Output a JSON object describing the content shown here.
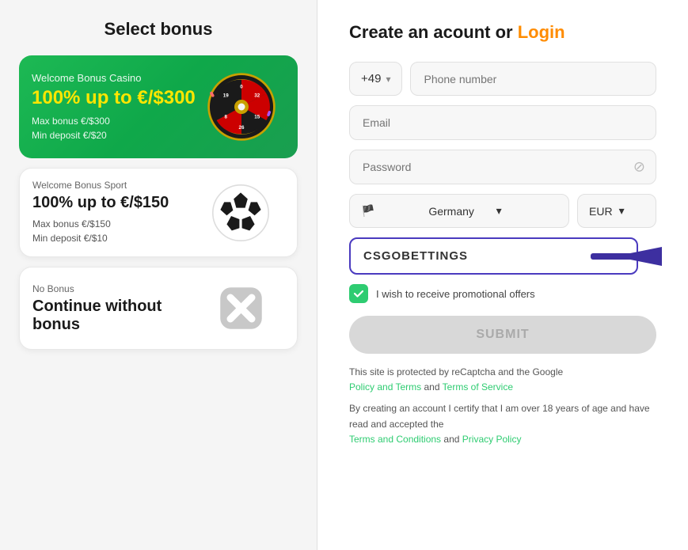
{
  "left": {
    "title": "Select bonus",
    "cards": [
      {
        "id": "casino",
        "type": "casino",
        "label": "Welcome Bonus Casino",
        "amount": "100% up to €/$300",
        "detail1": "Max bonus €/$300",
        "detail2": "Min deposit €/$20"
      },
      {
        "id": "sport",
        "type": "sport",
        "label": "Welcome Bonus Sport",
        "amount": "100% up to €/$150",
        "detail1": "Max bonus €/$150",
        "detail2": "Min deposit €/$10"
      },
      {
        "id": "nobonus",
        "type": "nobonus",
        "label": "No Bonus",
        "amount": "Continue without bonus",
        "detail1": "",
        "detail2": ""
      }
    ]
  },
  "right": {
    "title": "Create an acount or",
    "login_label": "Login",
    "phone_code": "+49",
    "phone_placeholder": "Phone number",
    "email_placeholder": "Email",
    "password_placeholder": "Password",
    "country_name": "Germany",
    "currency": "EUR",
    "promo_code": "CSGOBETTINGS",
    "promo_clear": "×",
    "checkbox_label": "I wish to receive promotional offers",
    "submit_label": "SUBMIT",
    "footer1": "This site is protected by reCaptcha and the Google",
    "footer1_link1": "Policy and Terms",
    "footer1_and1": "and",
    "footer1_link2": "Terms of Service",
    "footer2": "By creating an account I certify that I am over 18 years of age and have read and accepted the",
    "footer2_link1": "Terms and Conditions",
    "footer2_and2": "and",
    "footer2_link2": "Privacy Policy"
  }
}
